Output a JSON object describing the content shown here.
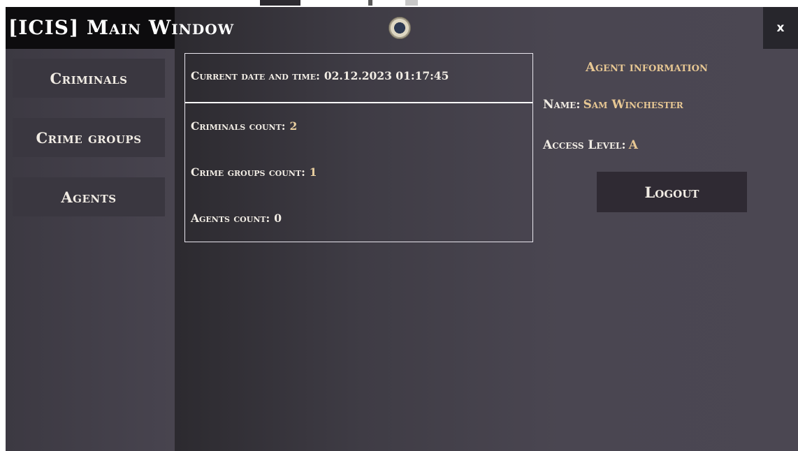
{
  "window": {
    "title": "[ICIS] Main Window",
    "close_label": "x",
    "emblem_icon": "agency-seal-icon"
  },
  "sidebar": {
    "items": [
      {
        "label": "Criminals"
      },
      {
        "label": "Crime groups"
      },
      {
        "label": "Agents"
      }
    ]
  },
  "stats": {
    "datetime_label": "Current date and time:",
    "datetime_value": "02.12.2023 01:17:45",
    "criminals_label": "Criminals count:",
    "criminals_value": "2",
    "crime_groups_label": "Crime groups count:",
    "crime_groups_value": "1",
    "agents_label": "Agents count:",
    "agents_value": "0"
  },
  "agent": {
    "heading": "Agent information",
    "name_label": "Name:",
    "name_value": "Sam Winchester",
    "access_label": "Access Level:",
    "access_value": "A",
    "logout_label": "Logout"
  },
  "colors": {
    "accent": "#e7c793",
    "text": "#f1ece4",
    "title_bar": "#0d0c0e",
    "panel": "#4a4651"
  }
}
